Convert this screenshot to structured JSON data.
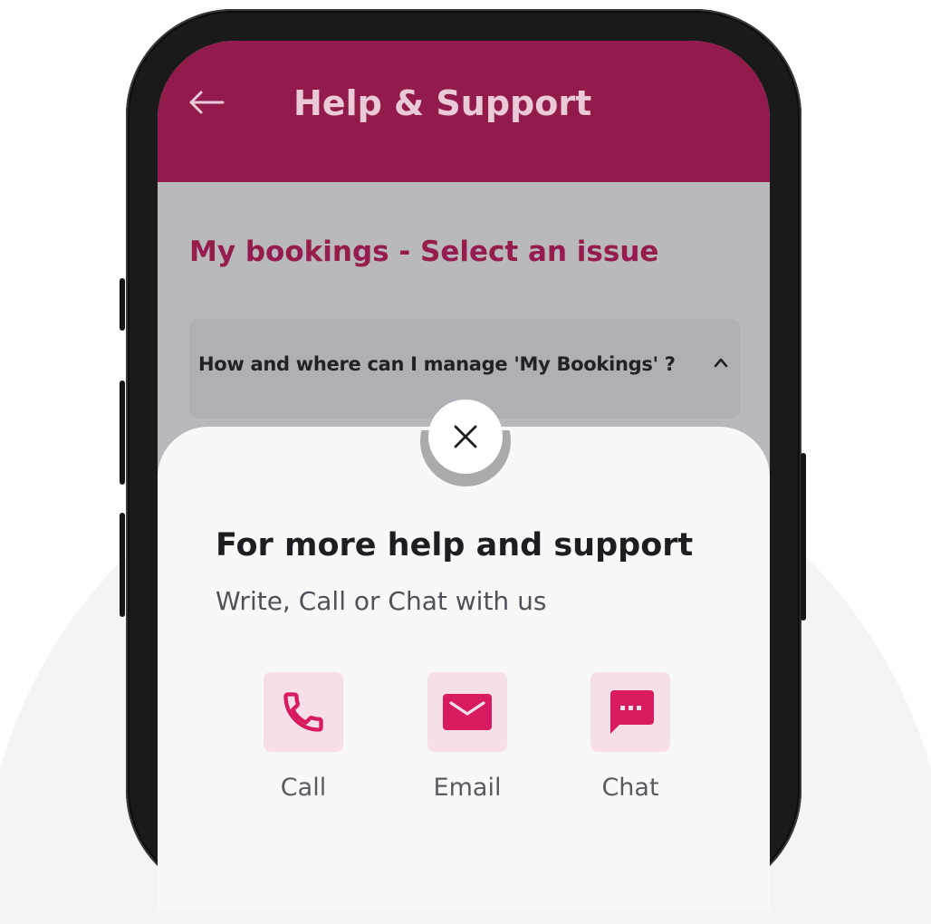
{
  "header": {
    "title": "Help & Support",
    "back_icon": "arrow-left-icon"
  },
  "section": {
    "title": "My bookings - Select an issue"
  },
  "faq": {
    "question": "How and where can I manage 'My Bookings' ?",
    "toggle_icon": "chevron-up-icon"
  },
  "support_sheet": {
    "close_icon": "close-icon",
    "title": "For more help and support",
    "subtitle": "Write, Call or Chat with us",
    "options": [
      {
        "label": "Call",
        "icon": "phone-icon"
      },
      {
        "label": "Email",
        "icon": "envelope-icon"
      },
      {
        "label": "Chat",
        "icon": "chat-icon"
      }
    ]
  },
  "colors": {
    "brand": "#931b4c",
    "accent": "#d81b60",
    "tile_bg": "#f7dfe8"
  }
}
